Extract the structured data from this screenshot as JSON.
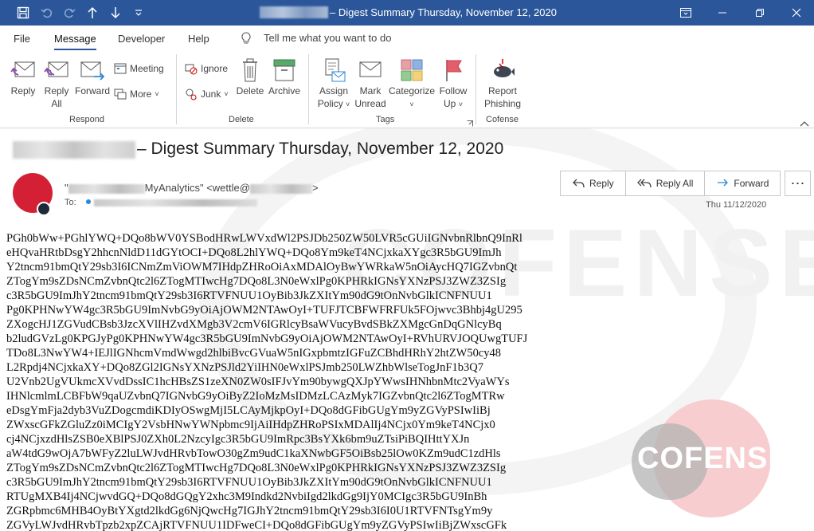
{
  "window": {
    "title": "– Digest Summary Thursday, November 12, 2020",
    "quick_access": [
      "save-icon",
      "undo-icon",
      "redo-icon",
      "up-arrow-icon",
      "down-arrow-icon",
      "customize-icon"
    ],
    "controls": [
      "restore-ribbon-icon",
      "minimize-icon",
      "maximize-icon",
      "close-icon"
    ]
  },
  "menu": {
    "items": [
      "File",
      "Message",
      "Developer",
      "Help"
    ],
    "active": "Message",
    "tell_me": "Tell me what you want to do"
  },
  "ribbon": {
    "respond": {
      "label": "Respond",
      "reply": "Reply",
      "reply_all_1": "Reply",
      "reply_all_2": "All",
      "forward": "Forward",
      "meeting": "Meeting",
      "more": "More"
    },
    "delete": {
      "label": "Delete",
      "ignore": "Ignore",
      "junk": "Junk",
      "delete": "Delete",
      "archive": "Archive"
    },
    "tags": {
      "label": "Tags",
      "assign_1": "Assign",
      "assign_2": "Policy",
      "mark_1": "Mark",
      "mark_2": "Unread",
      "categorize": "Categorize",
      "follow_1": "Follow",
      "follow_2": "Up"
    },
    "cofense": {
      "label": "Cofense",
      "report_1": "Report",
      "report_2": "Phishing"
    }
  },
  "message": {
    "subject": "– Digest Summary Thursday, November 12, 2020",
    "from_prefix": "\"",
    "from_name": "MyAnalytics\" <wettle@",
    "from_suffix": ">",
    "to_label": "To:",
    "date": "Thu 11/12/2020",
    "actions": {
      "reply": "Reply",
      "reply_all": "Reply All",
      "forward": "Forward"
    },
    "body_lines": [
      "PGh0bWw+PGhlYWQ+DQo8bWV0YSBodHRwLWVxdWl2PSJDb250ZW50LVR5cGUiIGNvbnRlbnQ9InRl",
      "eHQvaHRtbDsgY2hhcnNldD11dGYtOCI+DQo8L2hlYWQ+DQo8Ym9keT4NCjxkaXYgc3R5bGU9ImJh",
      "Y2tncm91bmQtY29sb3I6ICNmZmViOWM7IHdpZHRoOiAxMDAlOyBwYWRkaW5nOiAycHQ7IGZvbnQt",
      "ZTogYm9sZDsNCmZvbnQtc2l6ZTogMTIwcHg7DQo8L3N0eWxlPg0KPHRkIGNsYXNzPSJ3ZWZ3ZSIg",
      "c3R5bGU9ImJhY2tncm91bmQtY29sb3I6RTVFNUU1OyBib3JkZXItYm90dG9tOnNvbGlkICNFNUU1",
      "Pg0KPHNwYW4gc3R5bGU9ImNvbG9yOiAjOWM2NTAwOyI+TUFJTCBFWFRFUk5FOjwvc3Bhbj4gU295",
      "ZXogcHJ1ZGVudCBsb3JzcXVlIHZvdXMgb3V2cmV6IGRlcyBsaWVucyBvdSBkZXMgcGnDqGNlcyBq",
      "b2ludGVzLg0KPGJyPg0KPHNwYW4gc3R5bGU9ImNvbG9yOiAjOWM2NTAwOyI+RVhURVJOQUwgTUFJ",
      "TDo8L3NwYW4+IEJlIGNhcmVmdWwgd2hlbiBvcGVuaW5nIGxpbmtzIGFuZCBhdHRhY2htZW50cy48",
      "L2Rpdj4NCjxkaXY+DQo8ZGl2IGNsYXNzPSJld2YiIHN0eWxlPSJmb250LWZhbWlseTogJnF1b3Q7",
      "U2Vnb2UgVUkmcXVvdDssIC1hcHBsZS1zeXN0ZW0sIFJvYm90bywgQXJpYWwsIHNhbnMtc2VyaWYs",
      "IHNlcmlmLCBFbW9qaUZvbnQ7IGNvbG9yOiByZ2IoMzMsIDMzLCAzMyk7IGZvbnQtc2l6ZTogMTRw",
      "eDsgYmFja2dyb3VuZDogcmdiKDIyOSwgMjI5LCAyMjkpOyI+DQo8dGFibGUgYm9yZGVyPSIwIiBj",
      "ZWxscGFkZGluZz0iMCIgY2VsbHNwYWNpbmc9IjAiIHdpZHRoPSIxMDAlIj4NCjx0Ym9keT4NCjx0",
      "cj4NCjxzdHlsZSB0eXBlPSJ0ZXh0L2NzcyIgc3R5bGU9ImRpc3BsYXk6bm9uZTsiPiBQIHttYXJn",
      "aW4tdG9wOjA7bWFyZ2luLWJvdHRvbTowO30gZm9udC1kaXNwbGF5OiBsb25lOw0KZm9udC1zdHls",
      "ZTogYm9sZDsNCmZvbnQtc2l6ZTogMTIwcHg7DQo8L3N0eWxlPg0KPHRkIGNsYXNzPSJ3ZWZ3ZSIg",
      "c3R5bGU9ImJhY2tncm91bmQtY29sb3I6RTVFNUU1OyBib3JkZXItYm90dG9tOnNvbGlkICNFNUU1",
      "RTUgMXB4Ij4NCjwvdGQ+DQo8dGQgY2xhc3M9Indkd2NvbiIgd2lkdGg9IjY0MCIgc3R5bGU9InBh",
      "ZGRpbmc6MHB4OyBtYXgtd2lkdGg6NjQwcHg7IGJhY2tncm91bmQtY29sb3I6I0U1RTVFNTsgYm9y",
      "ZGVyLWJvdHRvbTpzb2xpZCAjRTVFNUU1IDFweCI+DQo8dGFibGUgYm9yZGVyPSIwIiBjZWxscGFk"
    ]
  },
  "brand": {
    "watermark": "COFENSE",
    "accent": "#2b579a",
    "avatar_color": "#d32034"
  }
}
